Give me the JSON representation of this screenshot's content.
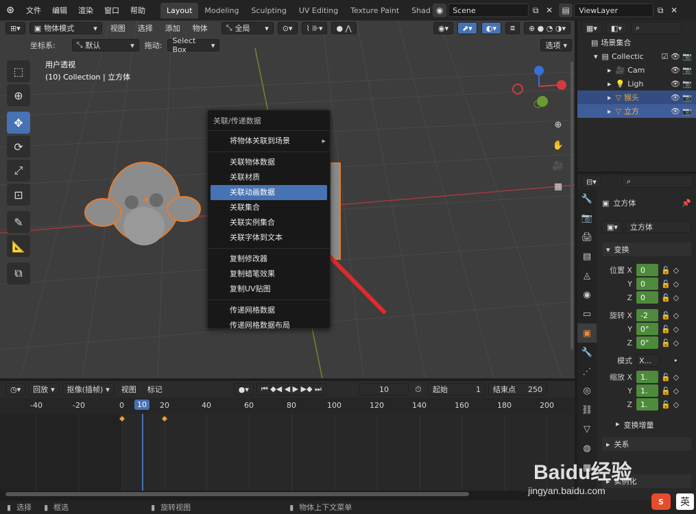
{
  "topbar": {
    "menus": [
      "文件",
      "编辑",
      "渲染",
      "窗口",
      "帮助"
    ],
    "workspaces": [
      "Layout",
      "Modeling",
      "Sculpting",
      "UV Editing",
      "Texture Paint",
      "Shadi"
    ],
    "scene": "Scene",
    "view_layer": "ViewLayer"
  },
  "viewport": {
    "mode": "物体模式",
    "menus": [
      "视图",
      "选择",
      "添加",
      "物体"
    ],
    "orientation": "全局",
    "coord_label": "坐标系:",
    "coord_value": "默认",
    "drag_label": "拖动:",
    "drag_value": "Select Box",
    "options": "选项",
    "view_name": "用户透视",
    "collection_info": "(10) Collection | 立方体"
  },
  "context_menu": {
    "title": "关联/传递数据",
    "items": [
      "将物体关联到场景",
      "关联物体数据",
      "关联材质",
      "关联动画数据",
      "关联集合",
      "关联实例集合",
      "关联字体到文本",
      "复制修改器",
      "复制蜡笔效果",
      "复制UV贴图",
      "传递网格数据",
      "传递网格数据布局"
    ]
  },
  "timeline": {
    "playback": "回放",
    "keying": "抠像(插帧)",
    "view": "视图",
    "marker": "标记",
    "current_frame": "10",
    "start_label": "起始",
    "start_value": "1",
    "end_label": "结束点",
    "end_value": "250",
    "ticks": [
      "-40",
      "-20",
      "0",
      "10",
      "20",
      "40",
      "60",
      "80",
      "100",
      "120",
      "140",
      "160",
      "180",
      "200"
    ]
  },
  "outliner": {
    "root": "场景集合",
    "collection": "Collectic",
    "items": [
      "Cam",
      "Ligh",
      "猴头",
      "立方"
    ]
  },
  "properties": {
    "object_name": "立方体",
    "data_name": "立方体",
    "transform": "变换",
    "location_label": "位置 X",
    "location": [
      "0",
      "0",
      "0"
    ],
    "rotation_label": "旋转 X",
    "rotation": [
      "-2",
      "0°",
      "0°"
    ],
    "mode_label": "模式",
    "mode_value": "X...",
    "scale_label": "缩放 X",
    "scale": [
      "1.",
      "1.",
      "1."
    ],
    "axis_y": "Y",
    "axis_z": "Z",
    "delta": "变换增量",
    "relations": "关系",
    "instancing": "实例化"
  },
  "statusbar": {
    "select": "选择",
    "box_select": "框选",
    "rotate": "旋转视图",
    "context_menu": "物体上下文菜单"
  },
  "watermark": {
    "brand": "Baidu经验",
    "url": "jingyan.baidu.com",
    "ime": "英"
  },
  "colors": {
    "accent": "#4772b3",
    "selection_outline": "#e87c2b",
    "field_green": "#4d8a3c",
    "arrow_red": "#e02a2a"
  }
}
